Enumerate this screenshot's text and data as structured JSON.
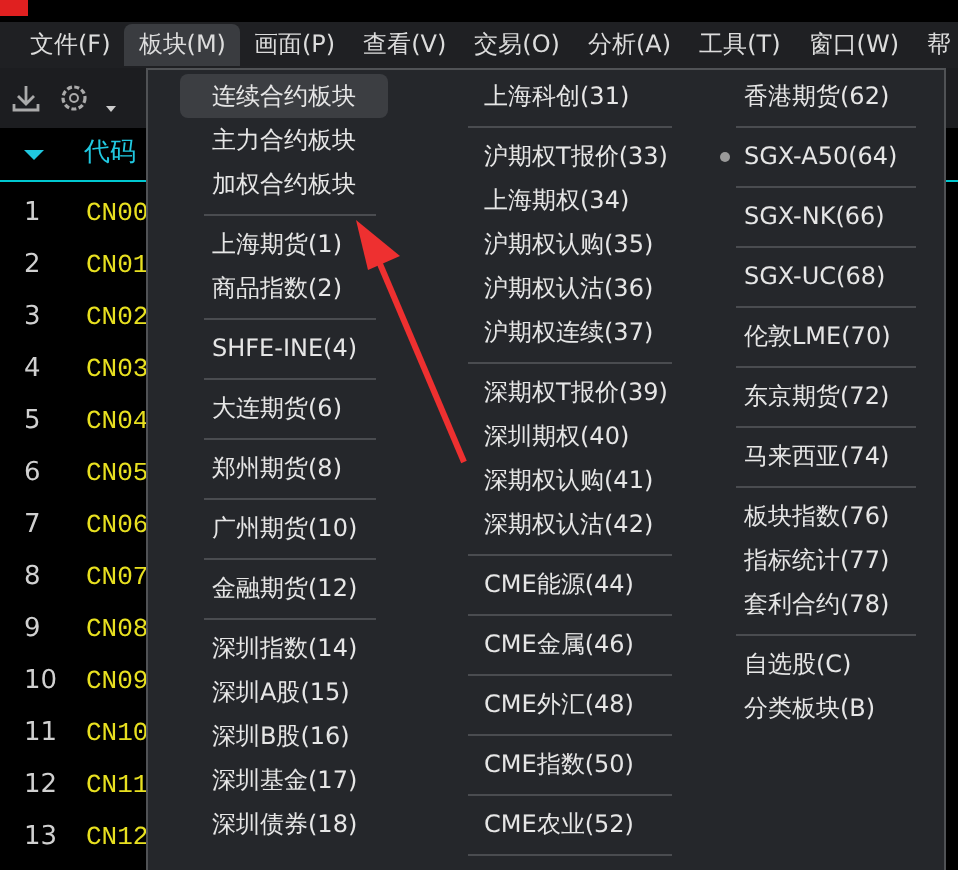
{
  "menu_bar": [
    {
      "label": "文件(F)",
      "selected": false
    },
    {
      "label": "板块(M)",
      "selected": true
    },
    {
      "label": "画面(P)",
      "selected": false
    },
    {
      "label": "查看(V)",
      "selected": false
    },
    {
      "label": "交易(O)",
      "selected": false
    },
    {
      "label": "分析(A)",
      "selected": false
    },
    {
      "label": "工具(T)",
      "selected": false
    },
    {
      "label": "窗口(W)",
      "selected": false
    },
    {
      "label": "帮",
      "selected": false
    }
  ],
  "table": {
    "columns": [
      {
        "label": "代码"
      }
    ],
    "rows": [
      {
        "index": "1",
        "code": "CN00"
      },
      {
        "index": "2",
        "code": "CN01"
      },
      {
        "index": "3",
        "code": "CN02"
      },
      {
        "index": "4",
        "code": "CN03"
      },
      {
        "index": "5",
        "code": "CN04"
      },
      {
        "index": "6",
        "code": "CN05"
      },
      {
        "index": "7",
        "code": "CN06"
      },
      {
        "index": "8",
        "code": "CN07"
      },
      {
        "index": "9",
        "code": "CN08"
      },
      {
        "index": "10",
        "code": "CN09"
      },
      {
        "index": "11",
        "code": "CN10"
      },
      {
        "index": "12",
        "code": "CN11"
      },
      {
        "index": "13",
        "code": "CN12"
      }
    ]
  },
  "dropdown_menu": {
    "columns": [
      [
        {
          "kind": "item",
          "label": "连续合约板块",
          "selected": true,
          "checked": false
        },
        {
          "kind": "item",
          "label": "主力合约板块",
          "selected": false,
          "checked": false
        },
        {
          "kind": "item",
          "label": "加权合约板块",
          "selected": false,
          "checked": false
        },
        {
          "kind": "separator"
        },
        {
          "kind": "item",
          "label": "上海期货(1)",
          "selected": false,
          "checked": false
        },
        {
          "kind": "item",
          "label": "商品指数(2)",
          "selected": false,
          "checked": false
        },
        {
          "kind": "separator"
        },
        {
          "kind": "item",
          "label": "SHFE-INE(4)",
          "selected": false,
          "checked": false
        },
        {
          "kind": "separator"
        },
        {
          "kind": "item",
          "label": "大连期货(6)",
          "selected": false,
          "checked": false
        },
        {
          "kind": "separator"
        },
        {
          "kind": "item",
          "label": "郑州期货(8)",
          "selected": false,
          "checked": false
        },
        {
          "kind": "separator"
        },
        {
          "kind": "item",
          "label": "广州期货(10)",
          "selected": false,
          "checked": false
        },
        {
          "kind": "separator"
        },
        {
          "kind": "item",
          "label": "金融期货(12)",
          "selected": false,
          "checked": false
        },
        {
          "kind": "separator"
        },
        {
          "kind": "item",
          "label": "深圳指数(14)",
          "selected": false,
          "checked": false
        },
        {
          "kind": "item",
          "label": "深圳A股(15)",
          "selected": false,
          "checked": false
        },
        {
          "kind": "item",
          "label": "深圳B股(16)",
          "selected": false,
          "checked": false
        },
        {
          "kind": "item",
          "label": "深圳基金(17)",
          "selected": false,
          "checked": false
        },
        {
          "kind": "item",
          "label": "深圳债券(18)",
          "selected": false,
          "checked": false
        }
      ],
      [
        {
          "kind": "item",
          "label": "上海科创(31)",
          "selected": false,
          "checked": false
        },
        {
          "kind": "separator"
        },
        {
          "kind": "item",
          "label": "沪期权T报价(33)",
          "selected": false,
          "checked": false
        },
        {
          "kind": "item",
          "label": "上海期权(34)",
          "selected": false,
          "checked": false
        },
        {
          "kind": "item",
          "label": "沪期权认购(35)",
          "selected": false,
          "checked": false
        },
        {
          "kind": "item",
          "label": "沪期权认沽(36)",
          "selected": false,
          "checked": false
        },
        {
          "kind": "item",
          "label": "沪期权连续(37)",
          "selected": false,
          "checked": false
        },
        {
          "kind": "separator"
        },
        {
          "kind": "item",
          "label": "深期权T报价(39)",
          "selected": false,
          "checked": false
        },
        {
          "kind": "item",
          "label": "深圳期权(40)",
          "selected": false,
          "checked": false
        },
        {
          "kind": "item",
          "label": "深期权认购(41)",
          "selected": false,
          "checked": false
        },
        {
          "kind": "item",
          "label": "深期权认沽(42)",
          "selected": false,
          "checked": false
        },
        {
          "kind": "separator"
        },
        {
          "kind": "item",
          "label": "CME能源(44)",
          "selected": false,
          "checked": false
        },
        {
          "kind": "separator"
        },
        {
          "kind": "item",
          "label": "CME金属(46)",
          "selected": false,
          "checked": false
        },
        {
          "kind": "separator"
        },
        {
          "kind": "item",
          "label": "CME外汇(48)",
          "selected": false,
          "checked": false
        },
        {
          "kind": "separator"
        },
        {
          "kind": "item",
          "label": "CME指数(50)",
          "selected": false,
          "checked": false
        },
        {
          "kind": "separator"
        },
        {
          "kind": "item",
          "label": "CME农业(52)",
          "selected": false,
          "checked": false
        },
        {
          "kind": "separator"
        }
      ],
      [
        {
          "kind": "item",
          "label": "香港期货(62)",
          "selected": false,
          "checked": false
        },
        {
          "kind": "separator"
        },
        {
          "kind": "item",
          "label": "SGX-A50(64)",
          "selected": false,
          "checked": true
        },
        {
          "kind": "separator"
        },
        {
          "kind": "item",
          "label": "SGX-NK(66)",
          "selected": false,
          "checked": false
        },
        {
          "kind": "separator"
        },
        {
          "kind": "item",
          "label": "SGX-UC(68)",
          "selected": false,
          "checked": false
        },
        {
          "kind": "separator"
        },
        {
          "kind": "item",
          "label": "伦敦LME(70)",
          "selected": false,
          "checked": false
        },
        {
          "kind": "separator"
        },
        {
          "kind": "item",
          "label": "东京期货(72)",
          "selected": false,
          "checked": false
        },
        {
          "kind": "separator"
        },
        {
          "kind": "item",
          "label": "马来西亚(74)",
          "selected": false,
          "checked": false
        },
        {
          "kind": "separator"
        },
        {
          "kind": "item",
          "label": "板块指数(76)",
          "selected": false,
          "checked": false
        },
        {
          "kind": "item",
          "label": "指标统计(77)",
          "selected": false,
          "checked": false
        },
        {
          "kind": "item",
          "label": "套利合约(78)",
          "selected": false,
          "checked": false
        },
        {
          "kind": "separator"
        },
        {
          "kind": "item",
          "label": "自选股(C)",
          "selected": false,
          "checked": false
        },
        {
          "kind": "item",
          "label": "分类板块(B)",
          "selected": false,
          "checked": false
        }
      ]
    ]
  }
}
